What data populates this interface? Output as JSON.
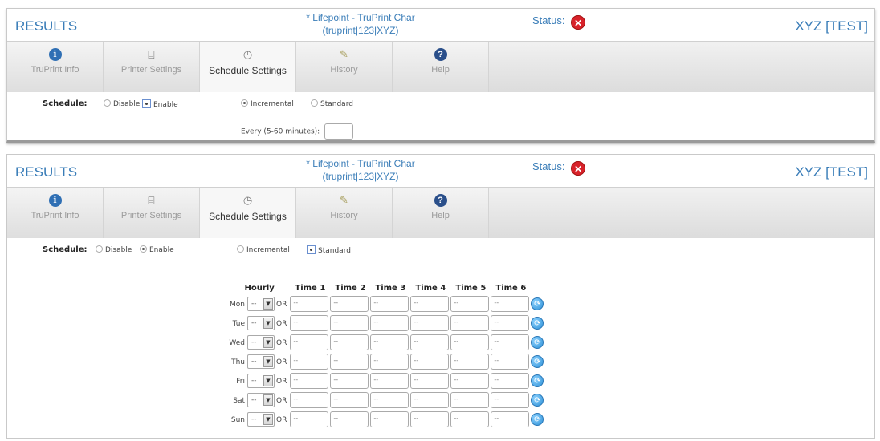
{
  "header": {
    "results": "RESULTS",
    "title_line1": "* Lifepoint - TruPrint Char",
    "title_line2": "(truprint|123|XYZ)",
    "status_label": "Status:",
    "status_icon": "error-x-icon",
    "environment": "XYZ [TEST]"
  },
  "tabs": [
    {
      "label": "TruPrint Info",
      "icon": "info-icon"
    },
    {
      "label": "Printer Settings",
      "icon": "printer-icon"
    },
    {
      "label": "Schedule Settings",
      "icon": "schedule-icon"
    },
    {
      "label": "History",
      "icon": "history-icon"
    },
    {
      "label": "Help",
      "icon": "help-icon"
    }
  ],
  "active_tab": "Schedule Settings",
  "panel_top": {
    "schedule_label": "Schedule:",
    "disable": "Disable",
    "enable": "Enable",
    "incremental": "Incremental",
    "standard": "Standard",
    "every_label": "Every (5-60 minutes):",
    "every_value": "",
    "selected_schedule": "Enable",
    "selected_mode": "Incremental"
  },
  "panel_bottom": {
    "schedule_label": "Schedule:",
    "disable": "Disable",
    "enable": "Enable",
    "incremental": "Incremental",
    "standard": "Standard",
    "selected_schedule": "Enable",
    "selected_mode": "Standard",
    "columns": [
      "Hourly",
      "Time 1",
      "Time 2",
      "Time 3",
      "Time 4",
      "Time 5",
      "Time 6"
    ],
    "or_label": "OR",
    "hourly_value": "--",
    "time_value": "--",
    "days": [
      "Mon",
      "Tue",
      "Wed",
      "Thu",
      "Fri",
      "Sat",
      "Sun"
    ]
  },
  "colors": {
    "accent": "#3a7db8",
    "status_error": "#d8222a"
  }
}
